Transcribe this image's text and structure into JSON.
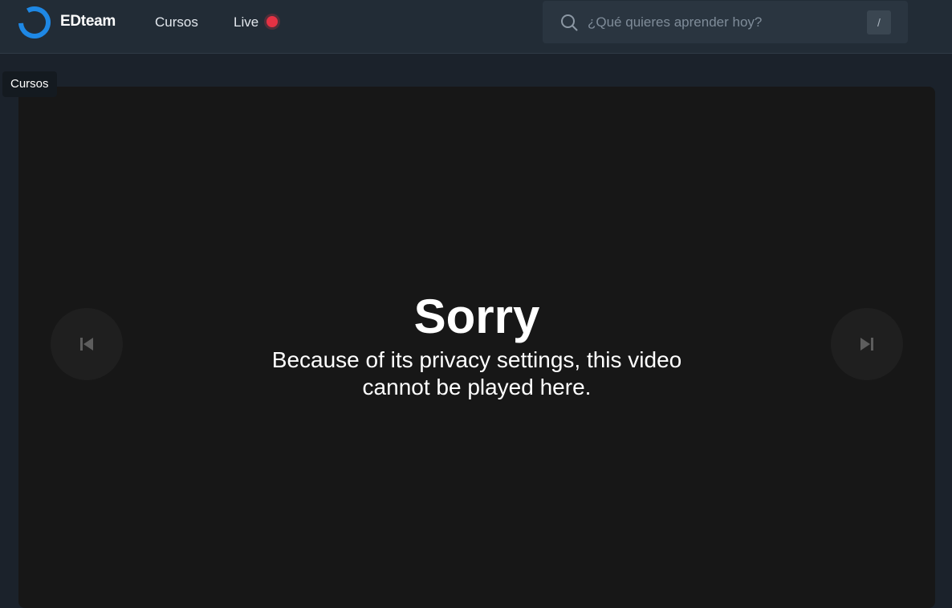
{
  "header": {
    "brand": "EDteam",
    "logo_icon": "edteam-logo-icon",
    "nav": {
      "cursos_label": "Cursos",
      "live_label": "Live",
      "live_indicator_color": "#e53244"
    },
    "search": {
      "icon": "search-icon",
      "placeholder": "¿Qué quieres aprender hoy?",
      "value": "",
      "shortcut_key": "/"
    }
  },
  "tooltip": {
    "text": "Cursos"
  },
  "player": {
    "title": "Sorry",
    "message": "Because of its privacy settings, this video cannot be played here.",
    "prev_icon": "skip-previous-icon",
    "next_icon": "skip-next-icon"
  },
  "colors": {
    "accent": "#1e88e5",
    "header_bg": "#222c36",
    "page_bg": "#1b222b",
    "player_bg": "#171717"
  }
}
